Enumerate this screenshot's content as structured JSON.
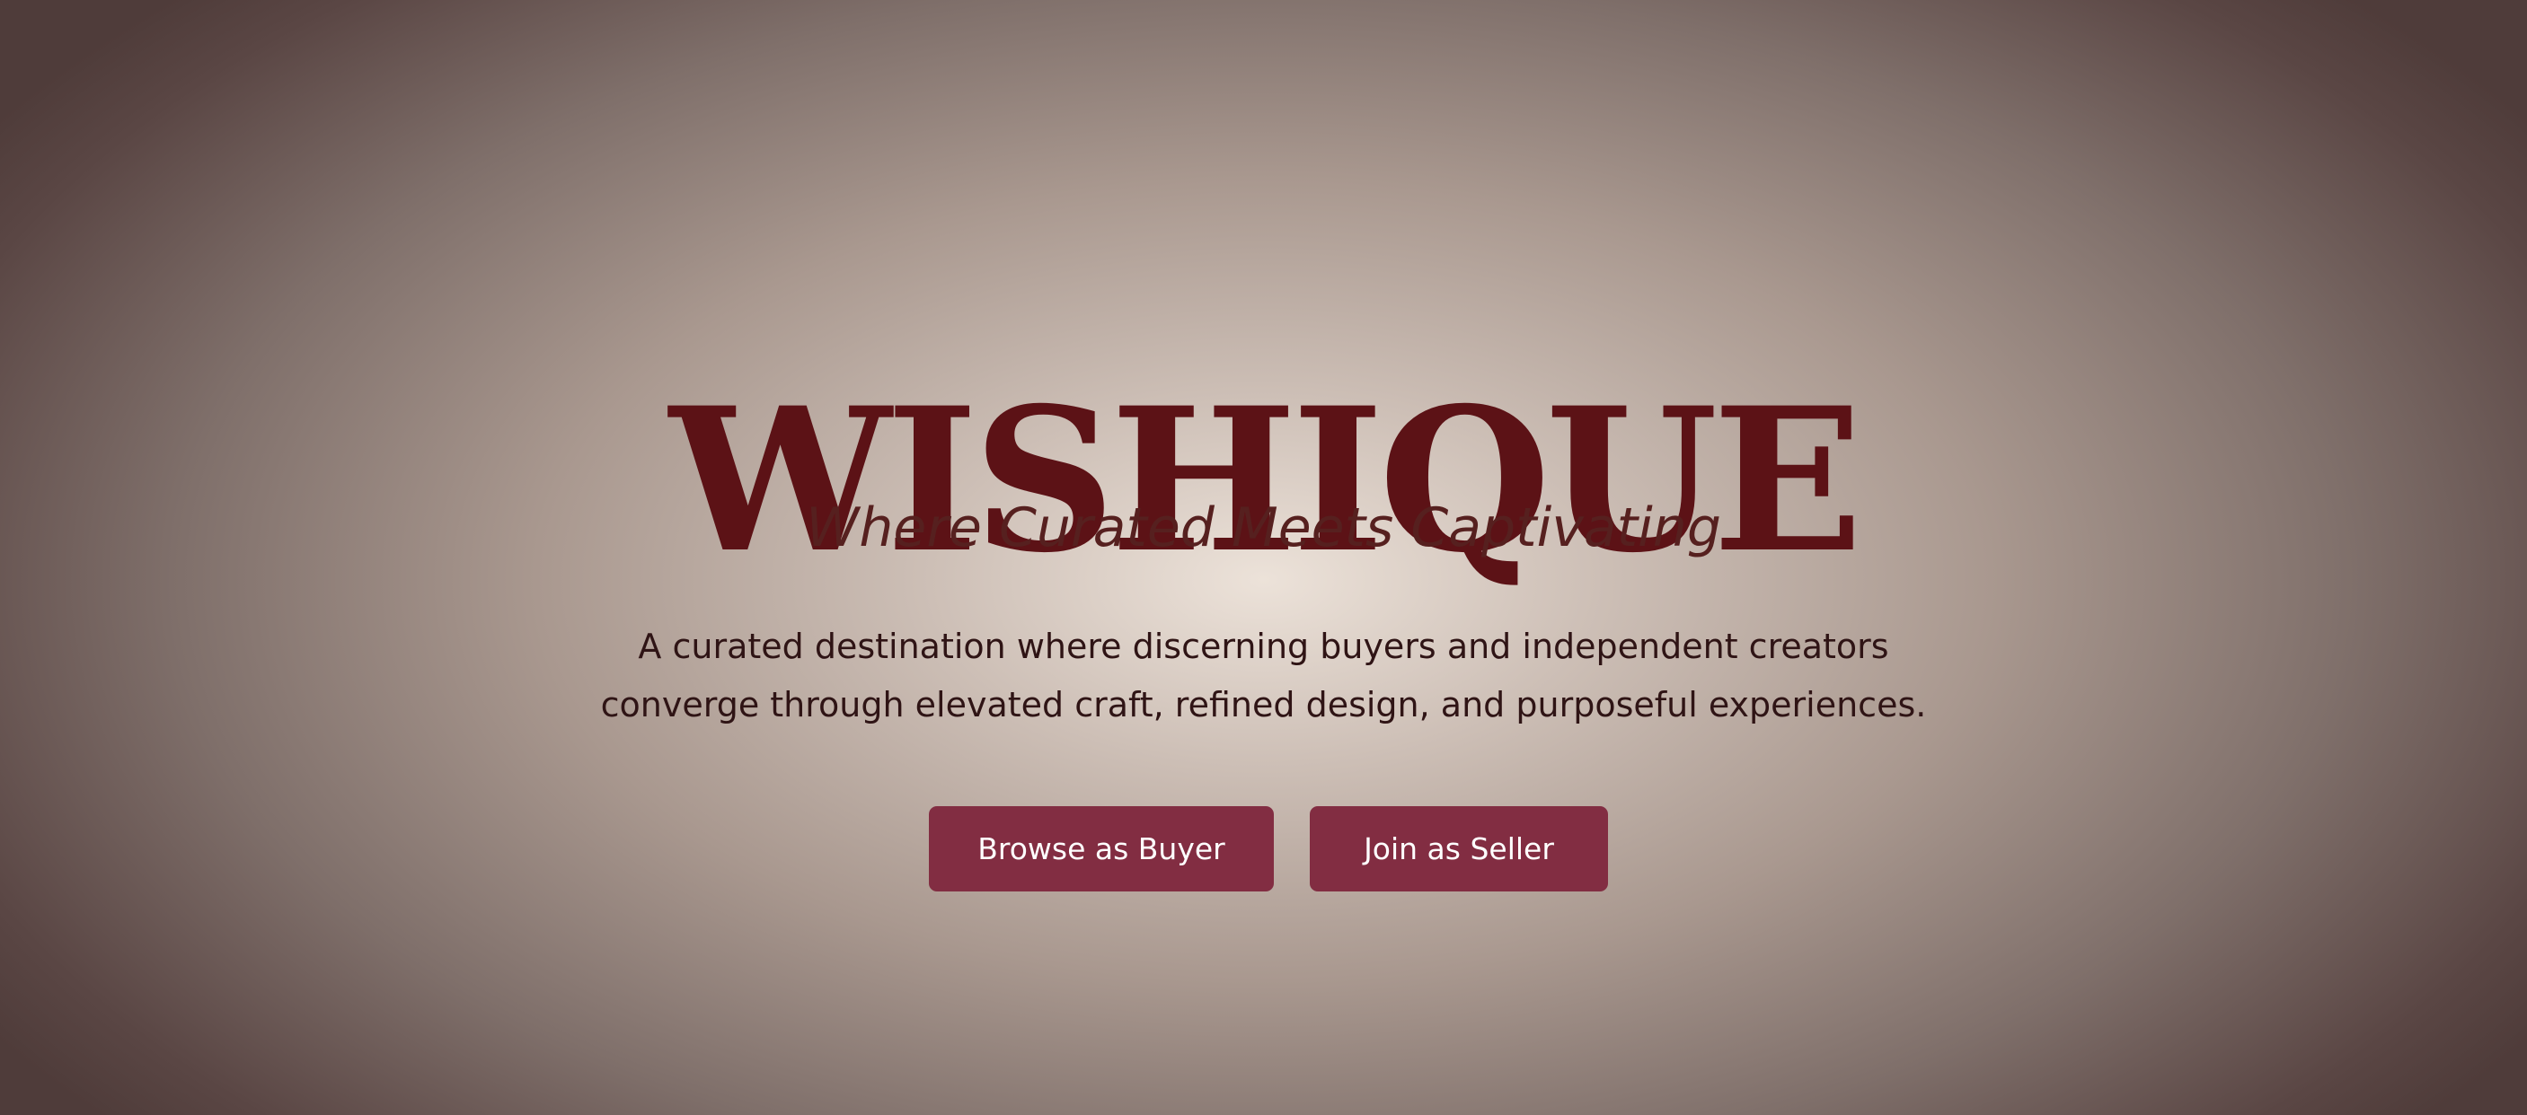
{
  "hero": {
    "logo_text": "WISHIQUE",
    "tagline": "Where Curated Meets Captivating",
    "description_line_1": "A curated destination where discerning buyers and independent creators",
    "description_line_2": "converge through elevated craft, refined design, and purposeful experiences.",
    "buttons": {
      "buyer_label": "Browse as Buyer",
      "seller_label": "Join as Seller"
    }
  },
  "colors": {
    "logo": "#5c1216",
    "tagline": "#56201f",
    "body_text": "#2f1415",
    "button_bg": "#822d42",
    "button_text": "#ffffff",
    "background_center": "#ece2d9",
    "background_edge": "#4f3c3a"
  }
}
